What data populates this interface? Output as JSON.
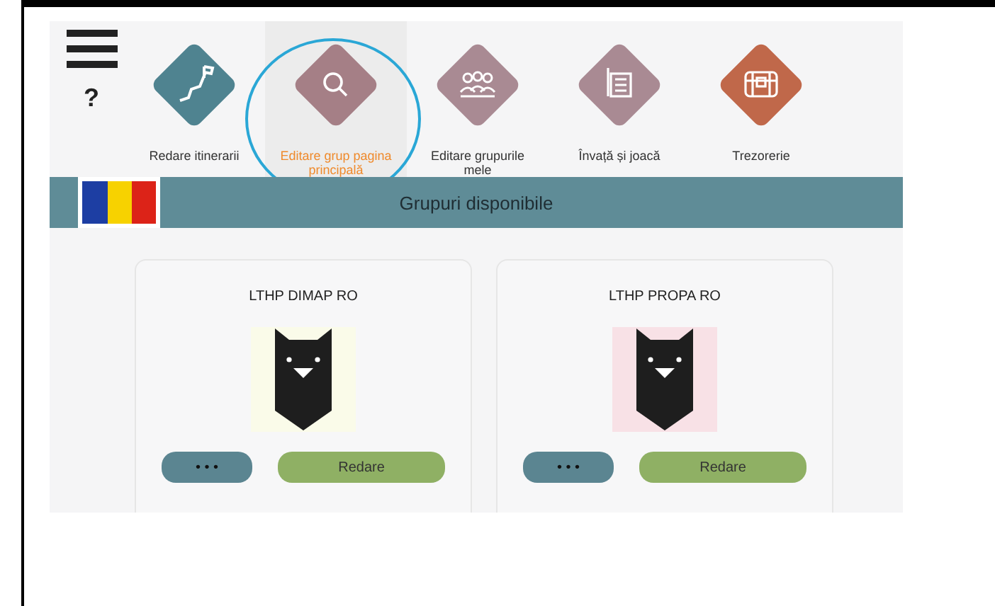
{
  "nav": {
    "help": "?",
    "items": [
      {
        "label": "Redare itinerarii",
        "color": "#4f8390",
        "selected": false
      },
      {
        "label": "Editare grup pagina principală",
        "color": "#a57f86",
        "selected": true
      },
      {
        "label": "Editare grupurile mele",
        "color": "#a98a93",
        "selected": false
      },
      {
        "label": "Învață și joacă",
        "color": "#a98a93",
        "selected": false
      },
      {
        "label": "Trezorerie",
        "color": "#c0684a",
        "selected": false
      }
    ]
  },
  "banner": {
    "title": "Grupuri disponibile"
  },
  "groups": [
    {
      "title": "LTHP DIMAP RO",
      "color": "#fafbe9",
      "more": "• • •",
      "play": "Redare"
    },
    {
      "title": "LTHP PROPA RO",
      "color": "#f8e1e6",
      "more": "• • •",
      "play": "Redare"
    }
  ]
}
